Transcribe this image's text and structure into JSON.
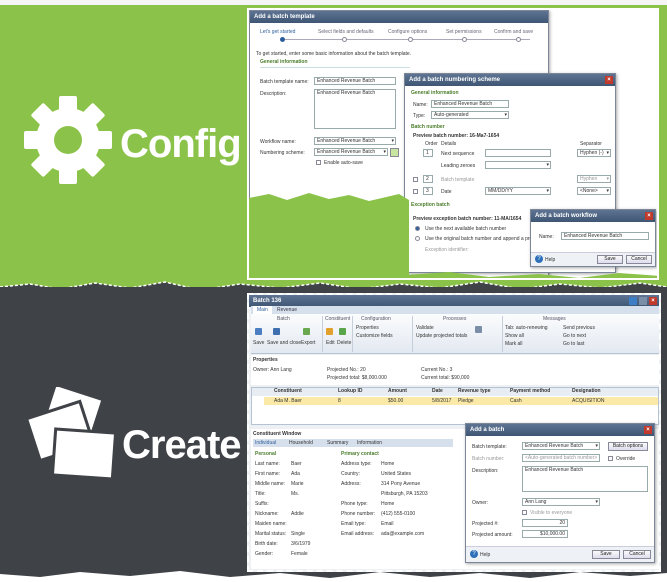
{
  "sections": {
    "config": "Config",
    "create": "Create"
  },
  "colors": {
    "green_band": "#8bc34a",
    "dark_band": "#3f4347",
    "window_title": "#4a6282"
  },
  "template_wizard": {
    "title": "Add a batch template",
    "steps": [
      "Let's get started",
      "Select fields and defaults",
      "Configure options",
      "Set permissions",
      "Confirm and save"
    ],
    "intro": "To get started, enter some basic information about the batch template.",
    "section": "General information",
    "name_label": "Batch template name:",
    "name_value": "Enhanced Revenue Batch",
    "desc_label": "Description:",
    "desc_value": "Enhanced Revenue Batch",
    "workflow_label": "Workflow name:",
    "workflow_value": "Enhanced Revenue Batch",
    "numbering_label": "Numbering scheme:",
    "numbering_value": "Enhanced Revenue Batch",
    "enable_autosave": "Enable auto-save"
  },
  "numbering_dialog": {
    "title": "Add a batch numbering scheme",
    "section1": "General information",
    "name_label": "Name:",
    "name_value": "Enhanced Revenue Batch",
    "type_label": "Type:",
    "type_value": "Auto-generated",
    "section2": "Batch number",
    "preview": "Preview batch number: 16-Ma7-1654",
    "order_label": "Order",
    "details_label": "Details",
    "separator_label": "Separator",
    "rows": [
      {
        "order": "1",
        "detail": "Next sequence",
        "sep": "Hyphen (-)"
      },
      {
        "order": "",
        "detail": "Leading zeroes",
        "sep": ""
      },
      {
        "order": "2",
        "detail": "Batch template",
        "sep": "Hyphen"
      },
      {
        "order": "3",
        "detail": "Date",
        "sep": "<None>"
      }
    ],
    "date_value": "MM/DD/YY",
    "section3": "Exception batch",
    "preview_exc": "Preview exception batch number: 11-MA/1654",
    "opt1": "Use the next available batch number",
    "opt2": "Use the original batch number and append a prefix",
    "exc_id_label": "Exception identifier:"
  },
  "workflow_dialog": {
    "title": "Add a batch workflow",
    "name_label": "Name:",
    "name_value": "Enhanced Revenue Batch",
    "help": "Help",
    "save": "Save",
    "cancel": "Cancel"
  },
  "batch_window": {
    "title": "Batch 136",
    "tabs": [
      "Main",
      "Revenue"
    ],
    "ribbon_groups": [
      "Batch",
      "Constituent",
      "Configuration",
      "Processes",
      "Messages"
    ],
    "ribbon_buttons": [
      "Save",
      "Save and close",
      "Export",
      "Edit",
      "Delete",
      "Properties",
      "Customize fields",
      "Validate",
      "Update projected totals",
      "Tab: auto-renewing",
      "Show all",
      "Send previous",
      "Go to next",
      "Mark all",
      "Go to last"
    ],
    "props_label": "Properties",
    "owner": "Owner: Ann Lang",
    "projected_no": "Projected No.: 20",
    "projected_total": "Projected total: $8,000.000",
    "current_no": "Current No.: 3",
    "current_total": "Current total: $90,000",
    "grid_headers": [
      "Constituent",
      "Lookup ID",
      "Amount",
      "Date",
      "Revenue type",
      "Payment method",
      "Designation"
    ],
    "grid_row": [
      "Ada M. Baer",
      "8",
      "$50.00",
      "5/8/2017",
      "Pledge",
      "Cash",
      "ACQUISITION"
    ],
    "search_label": "Constituent Window",
    "cw_tabs": [
      "Individual",
      "Household",
      "Summary",
      "Information"
    ],
    "personal_label": "Personal",
    "primary_label": "Primary contact",
    "personal_rows": [
      [
        "Last name:",
        "Baer"
      ],
      [
        "First name:",
        "Ada"
      ],
      [
        "Middle name:",
        "Marie"
      ],
      [
        "Title:",
        "Ms."
      ],
      [
        "Suffix:",
        ""
      ],
      [
        "Nickname:",
        "Addie"
      ],
      [
        "Maiden name:",
        ""
      ],
      [
        "Marital status:",
        "Single"
      ],
      [
        "Birth date:",
        "3/6/1979"
      ],
      [
        "Gender:",
        "Female"
      ]
    ],
    "contact_rows": [
      [
        "Address type:",
        "Home"
      ],
      [
        "Country:",
        "United States"
      ],
      [
        "Address:",
        "314 Pony Avenue"
      ],
      [
        "",
        "Pittsburgh, PA 15203"
      ],
      [
        "Phone type:",
        "Home"
      ],
      [
        "Phone number:",
        "(412) 555-0100"
      ],
      [
        "Email type:",
        "Email"
      ],
      [
        "Email address:",
        "ada@example.com"
      ]
    ]
  },
  "add_batch_dialog": {
    "title": "Add a batch",
    "template_label": "Batch template:",
    "template_value": "Enhanced Revenue Batch",
    "number_label": "Batch number:",
    "number_placeholder": "<Auto-generated batch number>",
    "override": "Override",
    "desc_label": "Description:",
    "desc_value": "Enhanced Revenue Batch",
    "owner_label": "Owner:",
    "owner_value": "Ann Lang",
    "visible": "Visible to everyone",
    "proj_no_label": "Projected #:",
    "proj_no_value": "20",
    "proj_amt_label": "Projected amount:",
    "proj_amt_value": "$10,000.00",
    "batch_options": "Batch options",
    "help": "Help",
    "save": "Save",
    "cancel": "Cancel"
  }
}
